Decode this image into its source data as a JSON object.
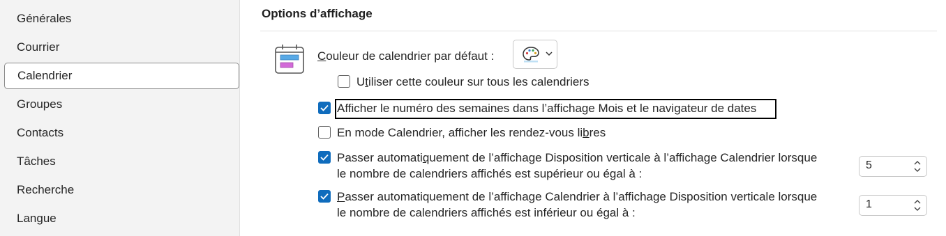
{
  "sidebar": {
    "items": [
      {
        "label": "Générales"
      },
      {
        "label": "Courrier"
      },
      {
        "label": "Calendrier",
        "active": true
      },
      {
        "label": "Groupes"
      },
      {
        "label": "Contacts"
      },
      {
        "label": "Tâches"
      },
      {
        "label": "Recherche"
      },
      {
        "label": "Langue"
      }
    ]
  },
  "main": {
    "section_title": "Options d’affichage",
    "default_color": {
      "label_first_letter": "C",
      "label_rest": "ouleur de calendrier par défaut :",
      "icon": "palette-icon"
    },
    "use_color_all": {
      "pre": "U",
      "accel": "t",
      "post": "iliser cette couleur sur tous les calendriers",
      "checked": false
    },
    "show_week_numbers": {
      "pre": "Afficher le numéro des semaines dans l’affichage Mois et le navigateur de dates",
      "checked": true
    },
    "show_free_appointments": {
      "pre": "En mode Calendrier, afficher les rendez-vous li",
      "accel": "b",
      "post": "res",
      "checked": false
    },
    "switch_to_calendar": {
      "line1_pre": "Passer automati",
      "line1_accel": "q",
      "line1_post": "uement de l’affichage Disposition verticale à l’affichage Calendrier lorsque",
      "line2": "le nombre de calendriers affichés est supérieur ou égal à :",
      "checked": true,
      "value": "5"
    },
    "switch_to_vertical": {
      "line1_pre": "",
      "line1_accel": "P",
      "line1_post": "asser automatiquement de l’affichage Calendrier à l’affichage Disposition verticale lorsque",
      "line2": "le nombre de calendriers affichés est inférieur ou égal à :",
      "checked": true,
      "value": "1"
    }
  },
  "colors": {
    "accent": "#0f6cbd",
    "sidebar_bg": "#f3f3f3"
  }
}
